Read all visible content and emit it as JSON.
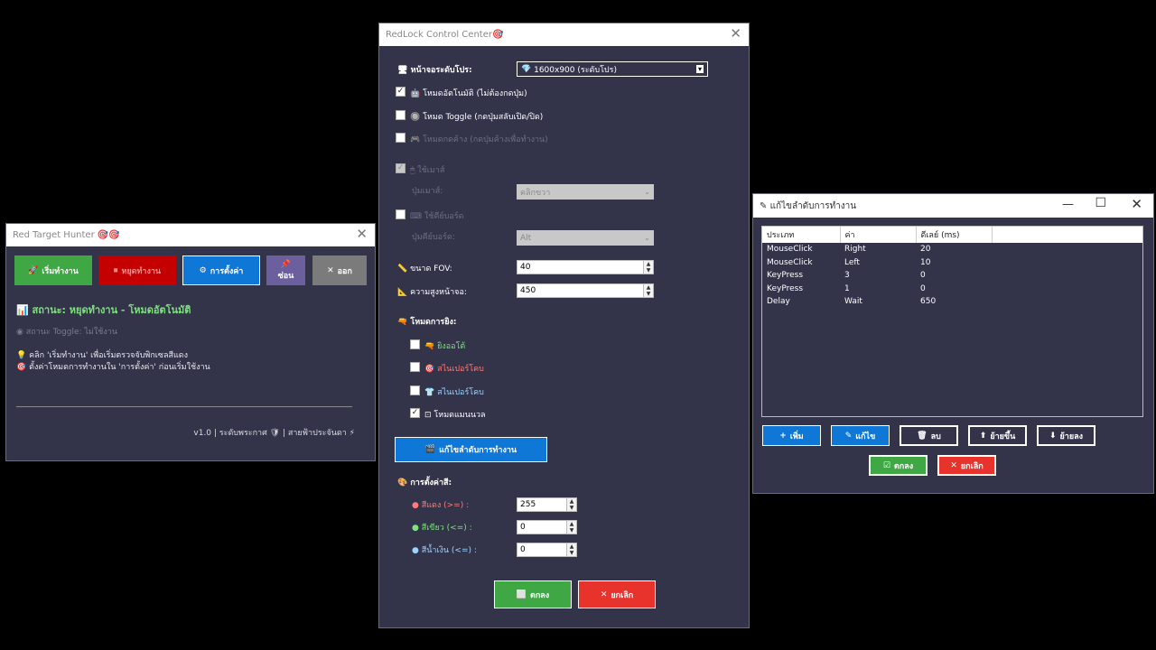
{
  "left": {
    "title": "Red Target Hunter 🎯🎯",
    "buttons": {
      "start": "เริ่มทำงาน",
      "stop": "หยุดทำงาน",
      "settings": "การตั้งค่า",
      "hide": "ซ่อน",
      "exit": "ออก"
    },
    "status": "สถานะ: หยุดทำงาน - โหมดอัตโนมัติ",
    "toggle_status": "สถานะ Toggle: ไม่ใช้งาน",
    "tip1": "คลิก 'เริ่มทำงาน' เพื่อเริ่มตรวจจับพิกเซลสีแดง",
    "tip2": "ตั้งค่าโหมดการทำงานใน 'การตั้งค่า' ก่อนเริ่มใช้งาน",
    "footer": "v1.0 | ระดับพระกาศ 🛡 | สายฟ้าประจันดา ⚡"
  },
  "center": {
    "title": "RedLock Control Center🎯",
    "screen_label": "หน้าจอระดับโปร:",
    "screen_value": "1600x900 (ระดับโปร)",
    "auto_mode": "โหมดอัตโนมัติ (ไม่ต้องกดปุ่ม)",
    "toggle_mode": "โหมด Toggle (กดปุ่มสลับเปิด/ปิด)",
    "hold_mode": "โหมดกดค้าง (กดปุ่มค้างเพื่อทำงาน)",
    "use_mouse": "ใช้เมาส์",
    "mouse_button_label": "ปุ่มเมาส์:",
    "mouse_button_value": "คลิกขวา",
    "use_keyboard": "ใช้คีย์บอร์ด",
    "keyboard_button_label": "ปุ่มคีย์บอร์ด:",
    "keyboard_button_value": "Alt",
    "fov_label": "ขนาด FOV:",
    "fov_value": "40",
    "height_label": "ความสูงหน้าจอ:",
    "height_value": "450",
    "fire_mode_label": "โหมดการยิง:",
    "fire_auto": "ยิงออโต้",
    "fire_sniper": "สไนเปอร์โคบ",
    "fire_sniper2": "สไนเปอร์โคบ",
    "fire_manual": "โหมดแมนนวล",
    "edit_sequence": "แก้ไขลำดับการทำงาน",
    "color_label": "การตั้งค่าสี:",
    "red_label": "สีแดง (>=) :",
    "red_value": "255",
    "green_label": "สีเขียว (<=) :",
    "green_value": "0",
    "blue_label": "สีน้ำเงิน (<=) :",
    "blue_value": "0",
    "ok": "ตกลง",
    "cancel": "ยกเลิก"
  },
  "right": {
    "title": "แก้ไขลำดับการทำงาน",
    "columns": [
      "ประเภท",
      "ค่า",
      "ดีเลย์ (ms)"
    ],
    "rows": [
      [
        "MouseClick",
        "Right",
        "20"
      ],
      [
        "MouseClick",
        "Left",
        "10"
      ],
      [
        "KeyPress",
        "3",
        "0"
      ],
      [
        "KeyPress",
        "1",
        "0"
      ],
      [
        "Delay",
        "Wait",
        "650"
      ]
    ],
    "buttons": {
      "add": "เพิ่ม",
      "edit": "แก้ไข",
      "delete": "ลบ",
      "up": "ย้ายขึ้น",
      "down": "ย้ายลง",
      "ok": "ตกลง",
      "cancel": "ยกเลิก"
    }
  },
  "colors": {
    "accent_blue": "#0f78d7",
    "green": "#3fa845",
    "red": "#e8332d",
    "purple": "#6b5f9e",
    "gray": "#7b7b7b"
  }
}
